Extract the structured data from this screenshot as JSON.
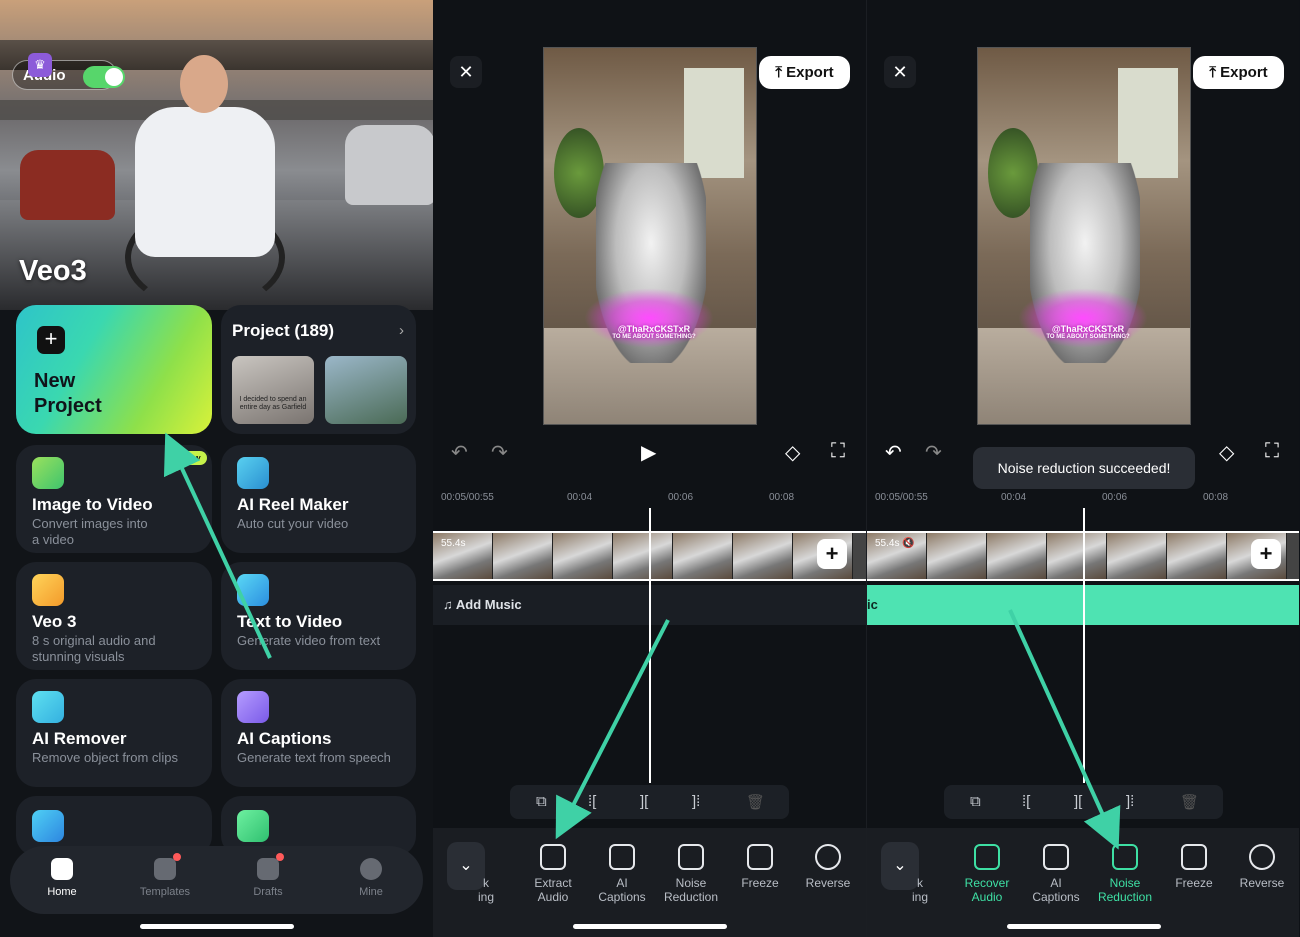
{
  "home": {
    "audio_toggle_label": "Audio",
    "hero_title": "Veo3",
    "new_project_label": "New\nProject",
    "project_card": {
      "title": "Project (189)",
      "thumb_caption": "I decided to spend an entire day as Garfield"
    },
    "new_badge": "New",
    "features": [
      {
        "title": "Image to Video",
        "subtitle": "Convert images into\na video"
      },
      {
        "title": "AI Reel Maker",
        "subtitle": "Auto cut your video"
      },
      {
        "title": "Veo 3",
        "subtitle": "8 s original audio and\nstunning visuals"
      },
      {
        "title": "Text to Video",
        "subtitle": "Generate video from text"
      },
      {
        "title": "AI Remover",
        "subtitle": "Remove object from clips"
      },
      {
        "title": "AI Captions",
        "subtitle": "Generate text from speech"
      }
    ],
    "nav": [
      {
        "label": "Home"
      },
      {
        "label": "Templates"
      },
      {
        "label": "Drafts"
      },
      {
        "label": "Mine"
      }
    ]
  },
  "editor": {
    "export_label": "Export",
    "close_glyph": "✕",
    "video_caption": "@ThaRxCKSTxR",
    "video_caption_small": "TO ME ABOUT SOMETHING?",
    "time_current": "00:05/00:55",
    "ticks": [
      "00:04",
      "00:06",
      "00:08"
    ],
    "clip_duration": "55.4s",
    "add_music_label": "Add Music",
    "music_track_fragment": "ic",
    "toast": "Noise reduction succeeded!",
    "partial_tool_label": "k\ning",
    "panel1_tools": [
      "Extract\nAudio",
      "AI\nCaptions",
      "Noise\nReduction",
      "Freeze",
      "Reverse"
    ],
    "panel2_tools": [
      "Recover\nAudio",
      "AI\nCaptions",
      "Noise\nReduction",
      "Freeze",
      "Reverse"
    ]
  },
  "colors": {
    "accent_green": "#3ee0a4",
    "wave_green": "#4ee3b2",
    "arrow": "#3fd1a6",
    "new_badge": "#c6f24a"
  }
}
